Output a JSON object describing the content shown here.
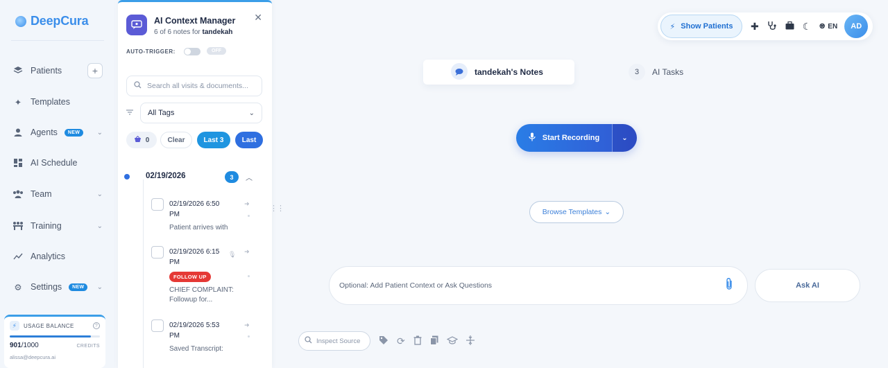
{
  "brand": {
    "name": "DeepCura"
  },
  "sidebar": {
    "items": [
      {
        "label": "Patients",
        "icon": "layers-icon"
      },
      {
        "label": "Templates",
        "icon": "sparkle-icon"
      },
      {
        "label": "Agents",
        "icon": "agent-icon",
        "badge": "NEW"
      },
      {
        "label": "AI Schedule",
        "icon": "grid-icon"
      },
      {
        "label": "Team",
        "icon": "team-icon"
      },
      {
        "label": "Training",
        "icon": "training-icon"
      },
      {
        "label": "Analytics",
        "icon": "chart-line-icon"
      },
      {
        "label": "Settings",
        "icon": "gear-icon",
        "badge": "NEW"
      }
    ],
    "usage": {
      "label": "USAGE BALANCE",
      "used": "901",
      "total": "/1000",
      "credits_label": "CREDITS",
      "fraction": 0.901,
      "email": "alissa@deepcura.ai"
    }
  },
  "context_panel": {
    "title": "AI Context Manager",
    "subtitle_prefix": "6 of 6 notes for",
    "patient": "tandekah",
    "auto_trigger_label": "AUTO-TRIGGER:",
    "auto_trigger_state": "OFF",
    "search_placeholder": "Search all visits & documents...",
    "tags_selected": "All Tags",
    "chips": {
      "basket_count": "0",
      "clear": "Clear",
      "last3": "Last 3",
      "last": "Last"
    },
    "date_group": {
      "date": "02/19/2026",
      "count": "3"
    },
    "notes": [
      {
        "time": "02/19/2026 6:50 PM",
        "text": "Patient arrives with"
      },
      {
        "time": "02/19/2026 6:15 PM",
        "badge": "FOLLOW UP",
        "text": "CHIEF COMPLAINT: Followup for..."
      },
      {
        "time": "02/19/2026 5:53 PM",
        "text": "Saved Transcript:"
      }
    ]
  },
  "topbar": {
    "show_patients": "Show Patients",
    "language": "EN",
    "avatar_initials": "AD"
  },
  "main": {
    "tab_notes": "tandekah's Notes",
    "tab_tasks_count": "3",
    "tab_tasks": "AI Tasks",
    "start_recording": "Start Recording",
    "browse_templates": "Browse Templates",
    "context_placeholder": "Optional: Add Patient Context or Ask Questions",
    "ask_ai": "Ask AI",
    "inspect_source": "Inspect Source"
  },
  "colors": {
    "accent": "#3b8eea",
    "primary": "#2f6fe0",
    "danger": "#e53935",
    "panel_icon": "#5b5bd6"
  }
}
